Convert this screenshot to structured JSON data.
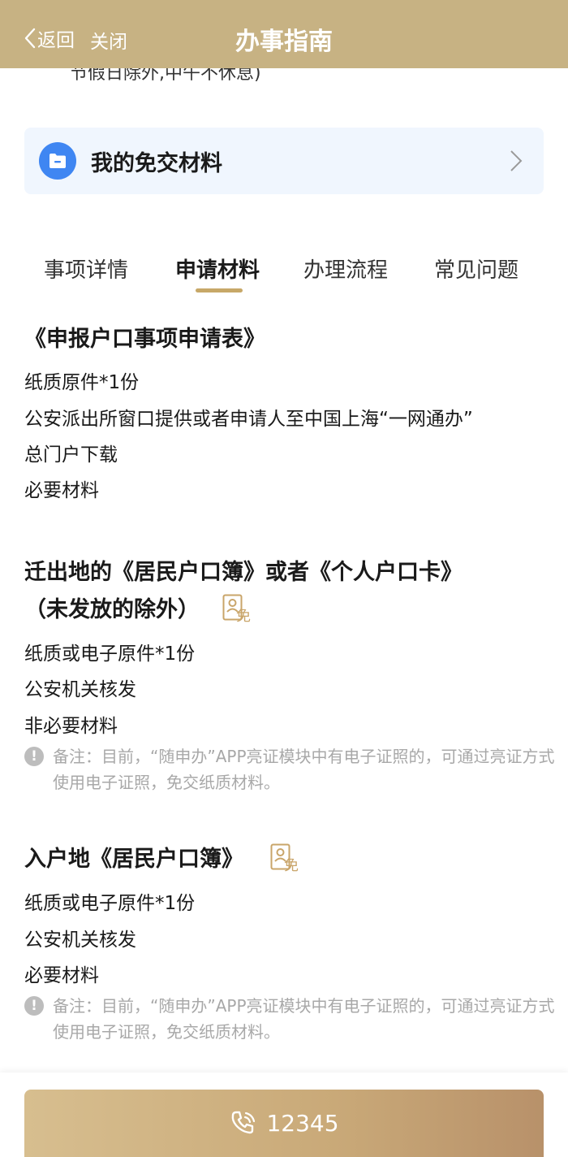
{
  "header": {
    "back_label": "返回",
    "close_label": "关闭",
    "title": "办事指南"
  },
  "partial_text": "节假日除外,中午不休息)",
  "free_materials": {
    "label": "我的免交材料"
  },
  "tabs": [
    {
      "label": "事项详情"
    },
    {
      "label": "申请材料"
    },
    {
      "label": "办理流程"
    },
    {
      "label": "常见问题"
    }
  ],
  "active_tab": 1,
  "materials": [
    {
      "title": "《申报户口事项申请表》",
      "lines": [
        "纸质原件*1份",
        "公安派出所窗口提供或者申请人至中国上海“一网通办”",
        "总门户下载",
        "必要材料"
      ]
    },
    {
      "title_line1": "迁出地的《居民户口簿》或者《个人户口卡》",
      "title_line2": "（未发放的除外）",
      "badge": "免",
      "lines": [
        "纸质或电子原件*1份",
        "公安机关核发",
        "非必要材料"
      ],
      "note": "备注：目前，“随申办”APP亮证模块中有电子证照的，可通过亮证方式使用电子证照，免交纸质材料。"
    },
    {
      "title": "入户地《居民户口簿》",
      "badge": "免",
      "lines": [
        "纸质或电子原件*1份",
        "公安机关核发",
        "必要材料"
      ],
      "note": "备注：目前，“随申办”APP亮证模块中有电子证照的，可通过亮证方式使用电子证照，免交纸质材料。"
    }
  ],
  "footer": {
    "phone_number": "12345"
  },
  "colors": {
    "header": "#c7b283",
    "accent": "#c7a868",
    "card": "#f0f6fe",
    "folder": "#3f86f2"
  }
}
